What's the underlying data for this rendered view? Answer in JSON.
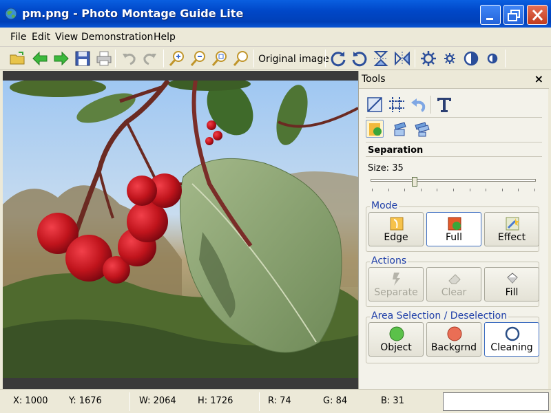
{
  "window": {
    "title": "pm.png - Photo Montage Guide Lite",
    "minimize_icon": "minimize-icon",
    "maximize_icon": "restore-icon",
    "close_icon": "close-icon"
  },
  "menu": [
    "File",
    "Edit",
    "View",
    "Demonstration",
    "Help"
  ],
  "toolbar": {
    "original_image_label": "Original image",
    "icons": [
      "open-folder-icon",
      "back-arrow-icon",
      "forward-arrow-icon",
      "save-icon",
      "print-icon",
      "undo-icon",
      "redo-icon",
      "zoom-in-icon",
      "zoom-out-icon",
      "zoom-fit-icon",
      "zoom-actual-icon",
      "rotate-right-icon",
      "rotate-left-icon",
      "flip-vertical-icon",
      "flip-horizontal-icon",
      "brightness-icon",
      "brightness-small-icon",
      "contrast-icon",
      "contrast-small-icon"
    ]
  },
  "tools": {
    "title": "Tools",
    "close": "×",
    "section_title": "Separation",
    "size_label": "Size: 35",
    "size_value": 35,
    "size_max": 100,
    "mode": {
      "title": "Mode",
      "buttons": [
        {
          "label": "Edge",
          "active": false,
          "disabled": false
        },
        {
          "label": "Full",
          "active": true,
          "disabled": false
        },
        {
          "label": "Effect",
          "active": false,
          "disabled": false
        }
      ]
    },
    "actions": {
      "title": "Actions",
      "buttons": [
        {
          "label": "Separate",
          "disabled": true
        },
        {
          "label": "Clear",
          "disabled": true
        },
        {
          "label": "Fill",
          "disabled": false
        }
      ]
    },
    "area": {
      "title": "Area Selection / Deselection",
      "buttons": [
        {
          "label": "Object",
          "active": false
        },
        {
          "label": "Backgrnd",
          "active": false
        },
        {
          "label": "Cleaning",
          "active": true
        }
      ]
    }
  },
  "status": {
    "x": "X: 1000",
    "y": "Y: 1676",
    "w": "W: 2064",
    "h": "H: 1726",
    "r": "R: 74",
    "g": "G: 84",
    "b": "B: 31"
  },
  "colors": {
    "title_bar": "#0047c8",
    "group_title": "#1e3ea8",
    "berry": "#c0141c",
    "leaf": "#7f9a64"
  }
}
